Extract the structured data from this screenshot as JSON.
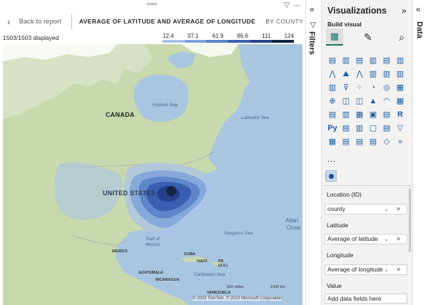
{
  "topbar": {
    "back_label": "Back to report",
    "visual_title": "AVERAGE OF LATITUDE AND AVERAGE OF LONGITUDE",
    "visual_subtitle": "BY COUNTY"
  },
  "status": {
    "displayed": "1503/1503 displayed"
  },
  "legend": {
    "labels": [
      "12.4",
      "37.1",
      "61.9",
      "86.6",
      "111",
      "124"
    ],
    "colors": [
      "#a9c3e8",
      "#7fa3db",
      "#5a82c8",
      "#3a5fb0",
      "#26418c",
      "#14233f"
    ]
  },
  "map": {
    "labels": {
      "canada": "CANADA",
      "united_states": "UNITED STATES",
      "mexico": "MEXICO",
      "hudson_bay": "Hudson Bay",
      "labrador_sea": "Labrador Sea",
      "sargasso_sea": "Sargasso Sea",
      "gulf_of_mexico": "Gulf of\nMexico",
      "cuba": "CUBA",
      "haiti": "HAITI",
      "pr": "PR\n(U.S.)",
      "caribbean_sea": "Caribbean Sea",
      "guatemala": "GUATEMALA",
      "nicaragua": "NICARAGUA",
      "venezuela": "VENEZUELA",
      "atlantic": "Atlan",
      "ocean": "Ocea"
    },
    "scale": {
      "miles": "500 miles",
      "km": "1000 km"
    },
    "copyright": "© 2023 TomTom, © 2023 Microsoft Corporation"
  },
  "filters": {
    "label": "Filters"
  },
  "visualizations": {
    "title": "Visualizations",
    "build_label": "Build visual",
    "more": "...",
    "wells": {
      "location": {
        "label": "Location (ID)",
        "field": "county"
      },
      "latitude": {
        "label": "Latitude",
        "field": "Average of latitude"
      },
      "longitude": {
        "label": "Longitude",
        "field": "Average of longitude"
      },
      "value": {
        "label": "Value",
        "placeholder": "Add data fields here"
      }
    }
  },
  "data_pane": {
    "label": "Data"
  }
}
